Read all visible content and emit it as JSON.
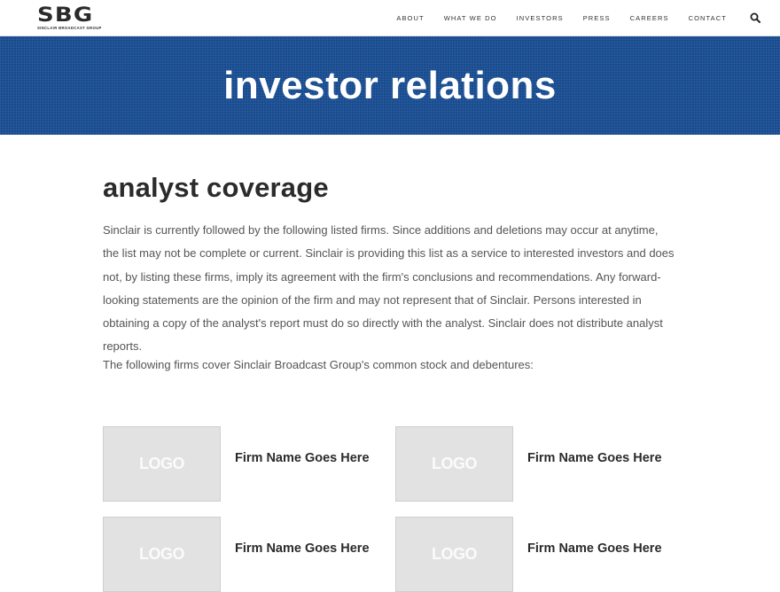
{
  "header": {
    "logo_text": "SBG",
    "logo_subtitle": "SINCLAIR BROADCAST GROUP",
    "nav": [
      "ABOUT",
      "WHAT WE DO",
      "INVESTORS",
      "PRESS",
      "CAREERS",
      "CONTACT"
    ]
  },
  "hero": {
    "title": "investor relations"
  },
  "main": {
    "title": "analyst coverage",
    "intro": "Sinclair is currently followed by the following listed firms. Since additions and deletions may occur at anytime, the list may not be complete or current. Sinclair is providing this list as a service to interested investors and does not, by listing these firms, imply its agreement with the firm's conclusions and recommendations. Any forward-looking statements are the opinion of the firm and may not represent that of Sinclair. Persons interested in obtaining a copy of the analyst's report must do so directly with the analyst. Sinclair does not distribute analyst reports.",
    "cover_note": "The following firms cover Sinclair Broadcast Group's common stock and debentures:",
    "firms": [
      {
        "logo_text": "LOGO",
        "name": "Firm Name Goes Here"
      },
      {
        "logo_text": "LOGO",
        "name": "Firm Name Goes Here"
      },
      {
        "logo_text": "LOGO",
        "name": "Firm Name Goes Here"
      },
      {
        "logo_text": "LOGO",
        "name": "Firm Name Goes Here"
      }
    ]
  },
  "colors": {
    "hero_bg": "#174b8f",
    "logo_placeholder": "#e1e2e1"
  },
  "icons": {
    "search": "search-icon"
  }
}
